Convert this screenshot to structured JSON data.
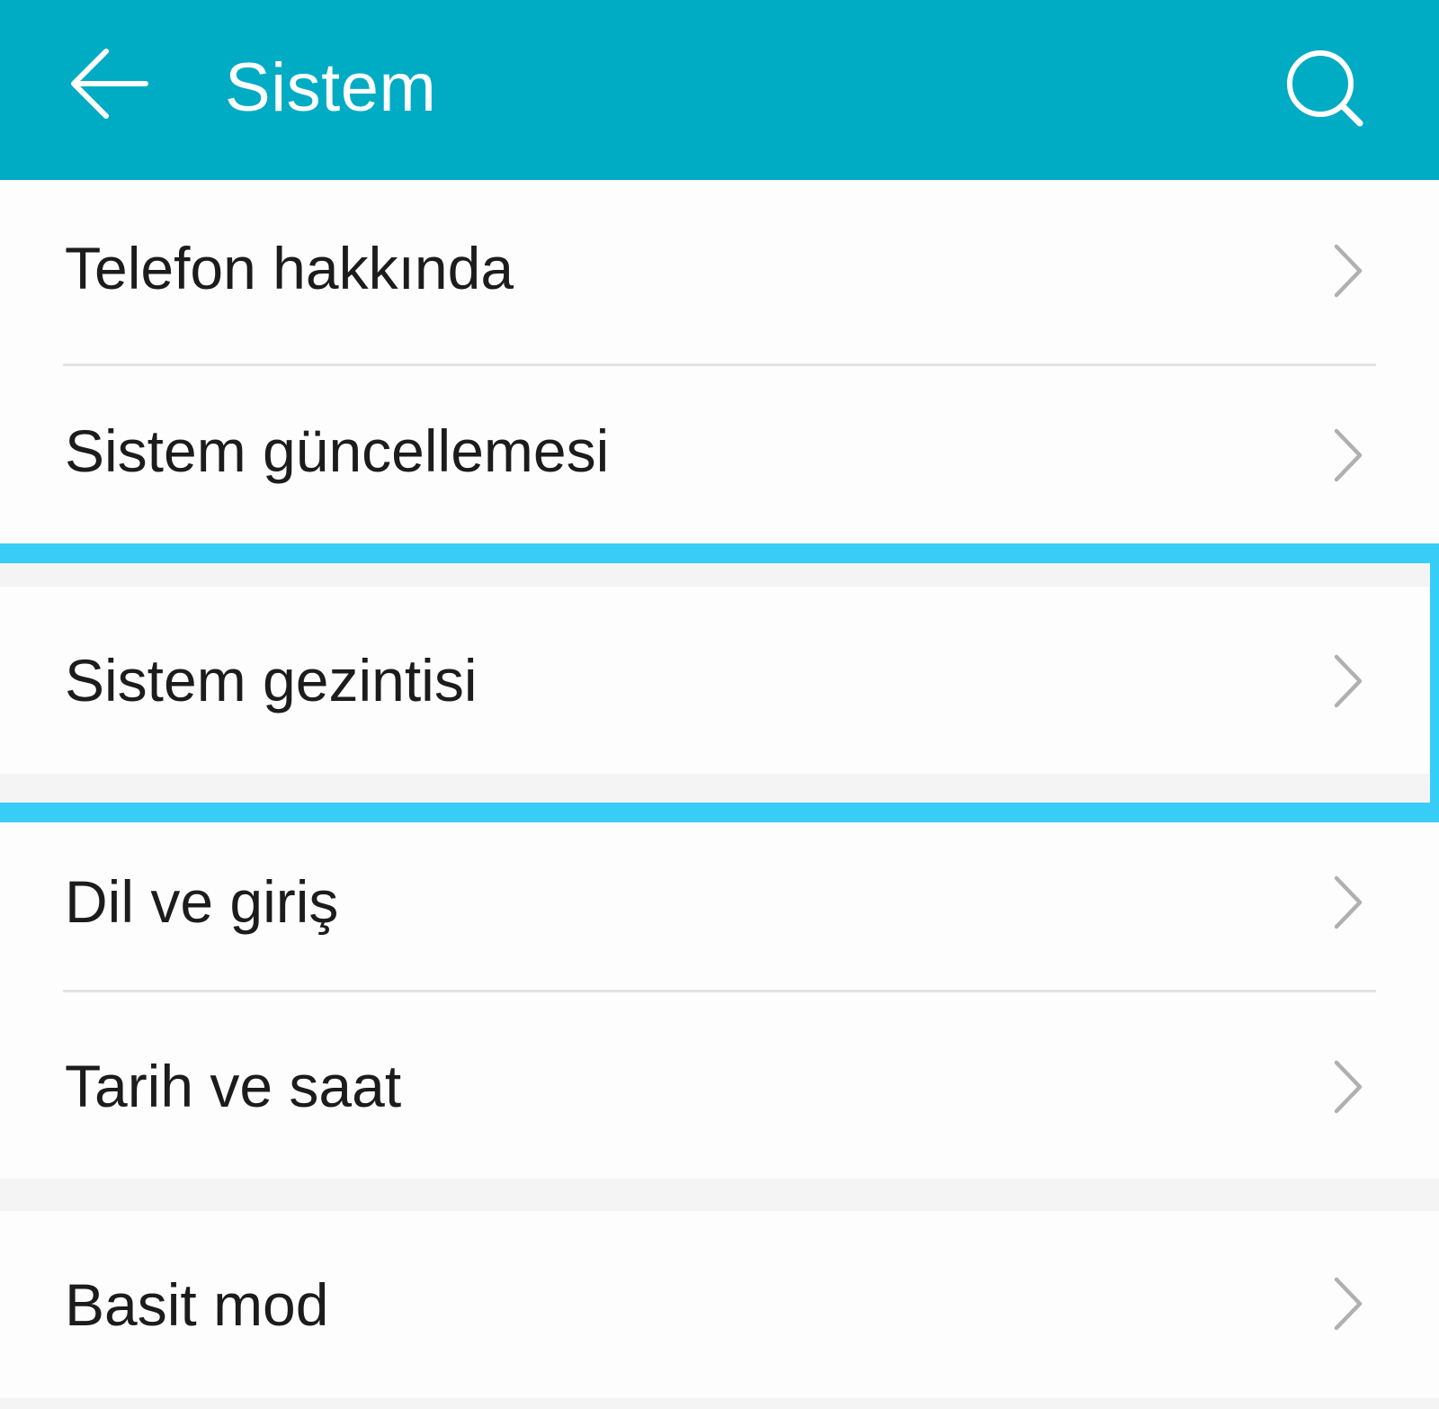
{
  "header": {
    "title": "Sistem",
    "back_icon": "arrow-left-icon",
    "search_icon": "search-icon"
  },
  "groups": [
    {
      "items": [
        {
          "label": "Telefon hakkında"
        },
        {
          "label": "Sistem güncellemesi"
        }
      ]
    },
    {
      "items": [
        {
          "label": "Sistem gezintisi",
          "highlighted": true
        }
      ]
    },
    {
      "items": [
        {
          "label": "Dil ve giriş"
        },
        {
          "label": "Tarih ve saat"
        }
      ]
    },
    {
      "items": [
        {
          "label": "Basit mod"
        }
      ]
    }
  ],
  "colors": {
    "appbar": "#00abc4",
    "highlight": "#38cdf6",
    "background": "#f4f4f4",
    "card": "#fdfdfd",
    "text": "#1c1c1c",
    "chevron": "#b0b0b0"
  }
}
